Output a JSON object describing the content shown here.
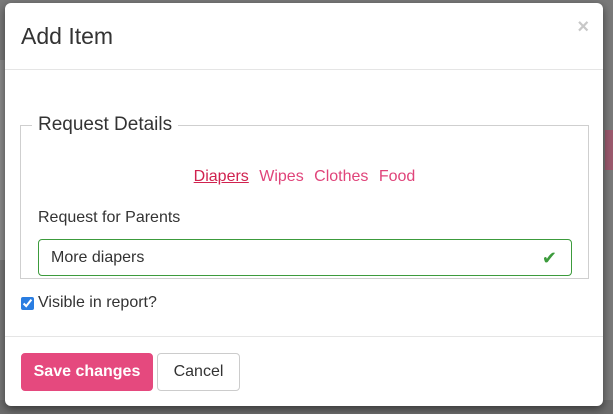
{
  "modal": {
    "title": "Add Item",
    "close_symbol": "×"
  },
  "request_details": {
    "legend": "Request Details",
    "tags": [
      {
        "label": "Diapers",
        "active": true
      },
      {
        "label": "Wipes",
        "active": false
      },
      {
        "label": "Clothes",
        "active": false
      },
      {
        "label": "Food",
        "active": false
      }
    ],
    "field_label": "Request for Parents",
    "field_value": "More diapers",
    "valid_icon": "check-icon"
  },
  "visible_in_report": {
    "label": "Visible in report?",
    "checked": true
  },
  "footer": {
    "save_label": "Save changes",
    "cancel_label": "Cancel"
  },
  "colors": {
    "accent": "#e5497e",
    "tag_link": "#e0447a",
    "tag_active": "#d0224f",
    "valid_green": "#3c9b3c"
  }
}
